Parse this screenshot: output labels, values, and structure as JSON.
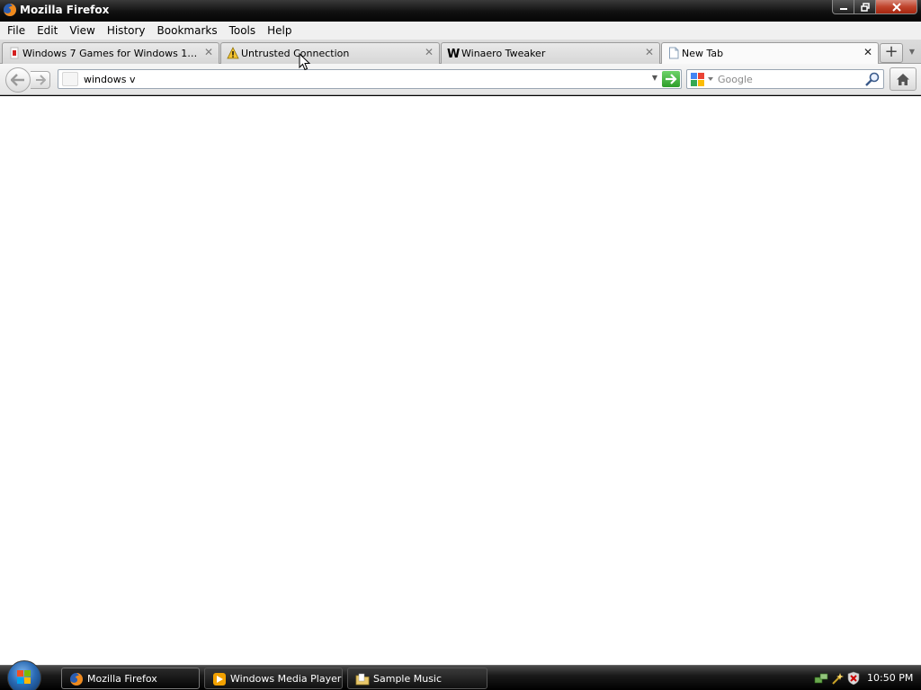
{
  "window": {
    "title": "Mozilla Firefox"
  },
  "menu": {
    "items": [
      {
        "label": "File"
      },
      {
        "label": "Edit"
      },
      {
        "label": "View"
      },
      {
        "label": "History"
      },
      {
        "label": "Bookmarks"
      },
      {
        "label": "Tools"
      },
      {
        "label": "Help"
      }
    ]
  },
  "tabs": [
    {
      "label": "Windows 7 Games for Windows 11, Win...",
      "icon": "page-favicon-icon"
    },
    {
      "label": "Untrusted Connection",
      "icon": "warning-icon"
    },
    {
      "label": "Winaero Tweaker",
      "icon": "winaero-w-icon"
    },
    {
      "label": "New Tab",
      "icon": "blank-page-icon"
    }
  ],
  "navbar": {
    "url_value": "windows v",
    "search_placeholder": "Google"
  },
  "taskbar": {
    "buttons": [
      {
        "label": "Mozilla Firefox",
        "icon": "firefox-icon"
      },
      {
        "label": "Windows Media Player",
        "icon": "media-player-icon"
      },
      {
        "label": "Sample Music",
        "icon": "folder-icon"
      }
    ],
    "clock": "10:50 PM"
  },
  "colors": {
    "go_button": "#2d9e2a",
    "close_button": "#c0442c",
    "taskbar": "#000000"
  }
}
